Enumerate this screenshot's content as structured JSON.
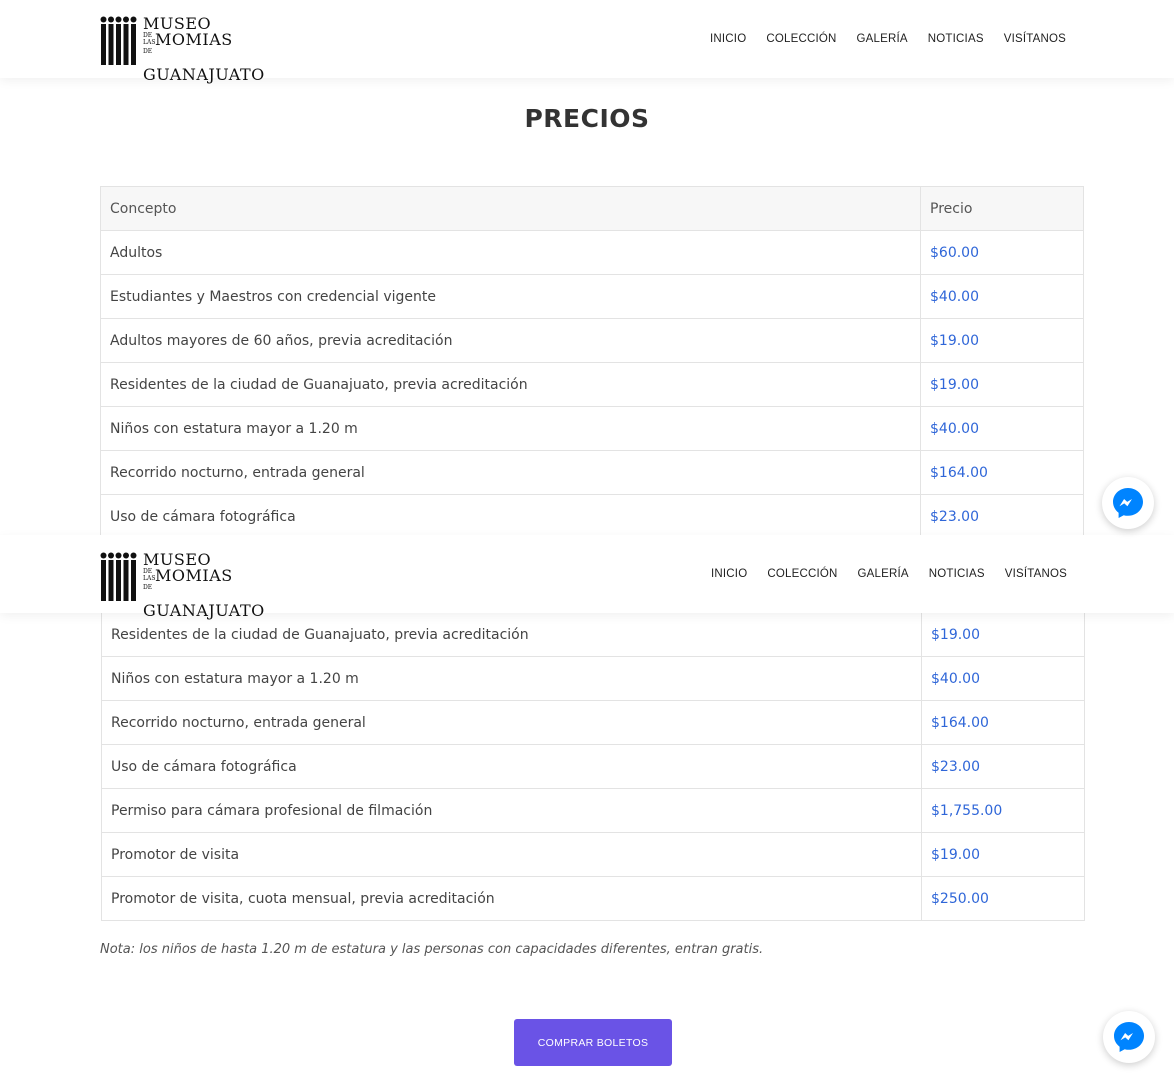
{
  "header": {
    "logo": {
      "line1": "MUSEO",
      "de_las": "DE LAS",
      "line2": "MOMIAS",
      "de": "DE",
      "line3": "GUANAJUATO"
    },
    "nav": [
      "INICIO",
      "COLECCIÓN",
      "GALERÍA",
      "NOTICIAS",
      "VISÍTANOS"
    ]
  },
  "section_title": "PRECIOS",
  "table_header": {
    "concept": "Concepto",
    "price": "Precio"
  },
  "table_top_rows": [
    {
      "concept": "Adultos",
      "price": "$60.00"
    },
    {
      "concept": "Estudiantes y Maestros con credencial vigente",
      "price": "$40.00"
    },
    {
      "concept": "Adultos mayores de 60 años, previa acreditación",
      "price": "$19.00"
    },
    {
      "concept": "Residentes de la ciudad de Guanajuato, previa acreditación",
      "price": "$19.00"
    },
    {
      "concept": "Niños con estatura mayor a 1.20 m",
      "price": "$40.00"
    },
    {
      "concept": "Recorrido nocturno, entrada general",
      "price": "$164.00"
    },
    {
      "concept": "Uso de cámara fotográfica",
      "price": "$23.00"
    }
  ],
  "table_bottom_rows": [
    {
      "concept": "Residentes de la ciudad de Guanajuato, previa acreditación",
      "price": "$19.00"
    },
    {
      "concept": "Niños con estatura mayor a 1.20 m",
      "price": "$40.00"
    },
    {
      "concept": "Recorrido nocturno, entrada general",
      "price": "$164.00"
    },
    {
      "concept": "Uso de cámara fotográfica",
      "price": "$23.00"
    },
    {
      "concept": "Permiso para cámara profesional de filmación",
      "price": "$1,755.00"
    },
    {
      "concept": "Promotor de visita",
      "price": "$19.00"
    },
    {
      "concept": "Promotor de visita, cuota mensual, previa acreditación",
      "price": "$250.00"
    }
  ],
  "note": "Nota: los niños de hasta 1.20 m de estatura y las personas con capacidades diferentes, entran gratis.",
  "buy_button": "COMPRAR BOLETOS",
  "colors": {
    "accent": "#6a53e6",
    "price_text": "#2f66d8",
    "messenger": "#0084ff"
  },
  "icons": {
    "messenger": "messenger-icon",
    "logo": "mummies-logo-icon"
  }
}
